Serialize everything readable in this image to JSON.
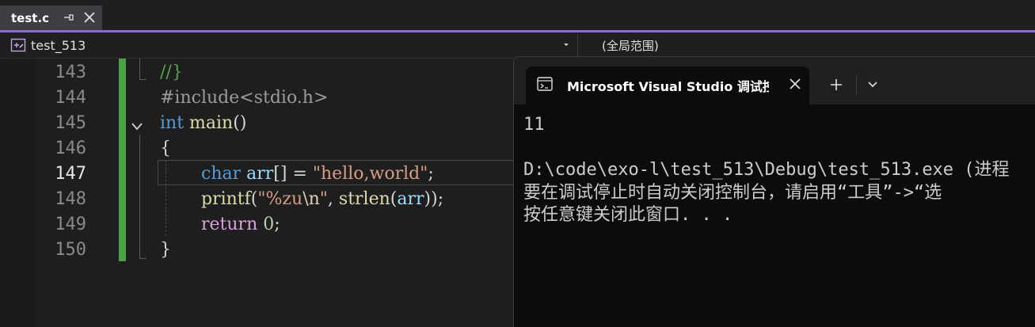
{
  "tab": {
    "title": "test.c"
  },
  "navbar": {
    "function": "test_513",
    "scope": "(全局范围)"
  },
  "editor": {
    "lines": [
      {
        "num": "143",
        "current": false
      },
      {
        "num": "144",
        "current": false
      },
      {
        "num": "145",
        "current": false
      },
      {
        "num": "146",
        "current": false
      },
      {
        "num": "147",
        "current": true
      },
      {
        "num": "148",
        "current": false
      },
      {
        "num": "149",
        "current": false
      },
      {
        "num": "150",
        "current": false
      }
    ],
    "code": {
      "l143": "//}",
      "l144": "#include<stdio.h>",
      "l145_kw": "int",
      "l145_fn": "main",
      "l145_rest": "()",
      "l146": "{",
      "l147_kw": "char",
      "l147_var": "arr",
      "l147_mid": "[] = ",
      "l147_str": "\"hello,world\"",
      "l147_end": ";",
      "l148_fn": "printf",
      "l148_open": "(",
      "l148_str1": "\"%zu",
      "l148_esc": "\\n",
      "l148_str2": "\"",
      "l148_sep": ", ",
      "l148_fn2": "strlen",
      "l148_open2": "(",
      "l148_var": "arr",
      "l148_end": "));",
      "l149_kw": "return",
      "l149_num": "0",
      "l149_end": ";",
      "l150": "}"
    }
  },
  "terminal": {
    "tab_title": "Microsoft Visual Studio 调试控",
    "output": [
      "11",
      "",
      "D:\\code\\exo-l\\test_513\\Debug\\test_513.exe (进程",
      "要在调试停止时自动关闭控制台，请启用“工具”->“选",
      "按任意键关闭此窗口. . ."
    ]
  },
  "colors": {
    "accent": "#8c6bd6",
    "change_bar": "#49a245",
    "keyword": "#569cd6",
    "control_keyword": "#d8a0df",
    "function": "#dcdcaa",
    "string": "#d69d85",
    "variable": "#9cdcfe",
    "comment": "#57a64a"
  },
  "icons": {
    "tab_pin": "pin-icon",
    "tab_close": "close-icon",
    "scope": "scope-icon",
    "nav_dropdown": "chevron-down-icon",
    "fold": "fold-chevron-icon",
    "terminal": "terminal-icon",
    "terminal_close": "close-icon",
    "new_tab": "plus-icon",
    "tab_dropdown": "chevron-down-icon"
  }
}
